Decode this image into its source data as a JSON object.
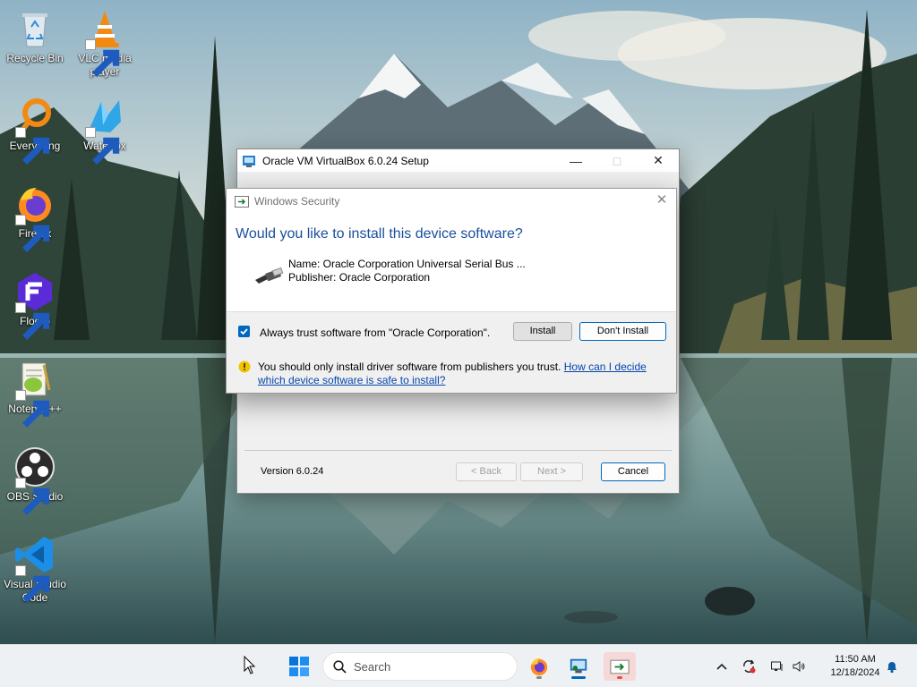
{
  "desktop": {
    "icons": [
      {
        "label": "Recycle Bin"
      },
      {
        "label": "VLC media player"
      },
      {
        "label": "Everything"
      },
      {
        "label": "Waterfox"
      },
      {
        "label": "Firefox"
      },
      {
        "label": "Floorp"
      },
      {
        "label": "Notepad++"
      },
      {
        "label": "OBS Studio"
      },
      {
        "label": "Visual Studio Code"
      }
    ]
  },
  "setup_window": {
    "title": "Oracle VM VirtualBox 6.0.24 Setup",
    "version_label": "Version 6.0.24",
    "back_label": "< Back",
    "next_label": "Next >",
    "cancel_label": "Cancel"
  },
  "security_dialog": {
    "title": "Windows Security",
    "heading": "Would you like to install this device software?",
    "device_name": "Name: Oracle Corporation Universal Serial Bus ...",
    "publisher": "Publisher: Oracle Corporation",
    "trust_checkbox_label": "Always trust software from \"Oracle Corporation\".",
    "trust_checked": true,
    "install_label": "Install",
    "dont_install_label": "Don't Install",
    "warning_text": "You should only install driver software from publishers you trust.",
    "warning_link": "How can I decide which device software is safe to install?"
  },
  "taskbar": {
    "search_placeholder": "Search",
    "time": "11:50 AM",
    "date": "12/18/2024"
  },
  "colors": {
    "accent": "#0067c0",
    "heading_blue": "#1a4f9c",
    "link": "#0645ad"
  }
}
